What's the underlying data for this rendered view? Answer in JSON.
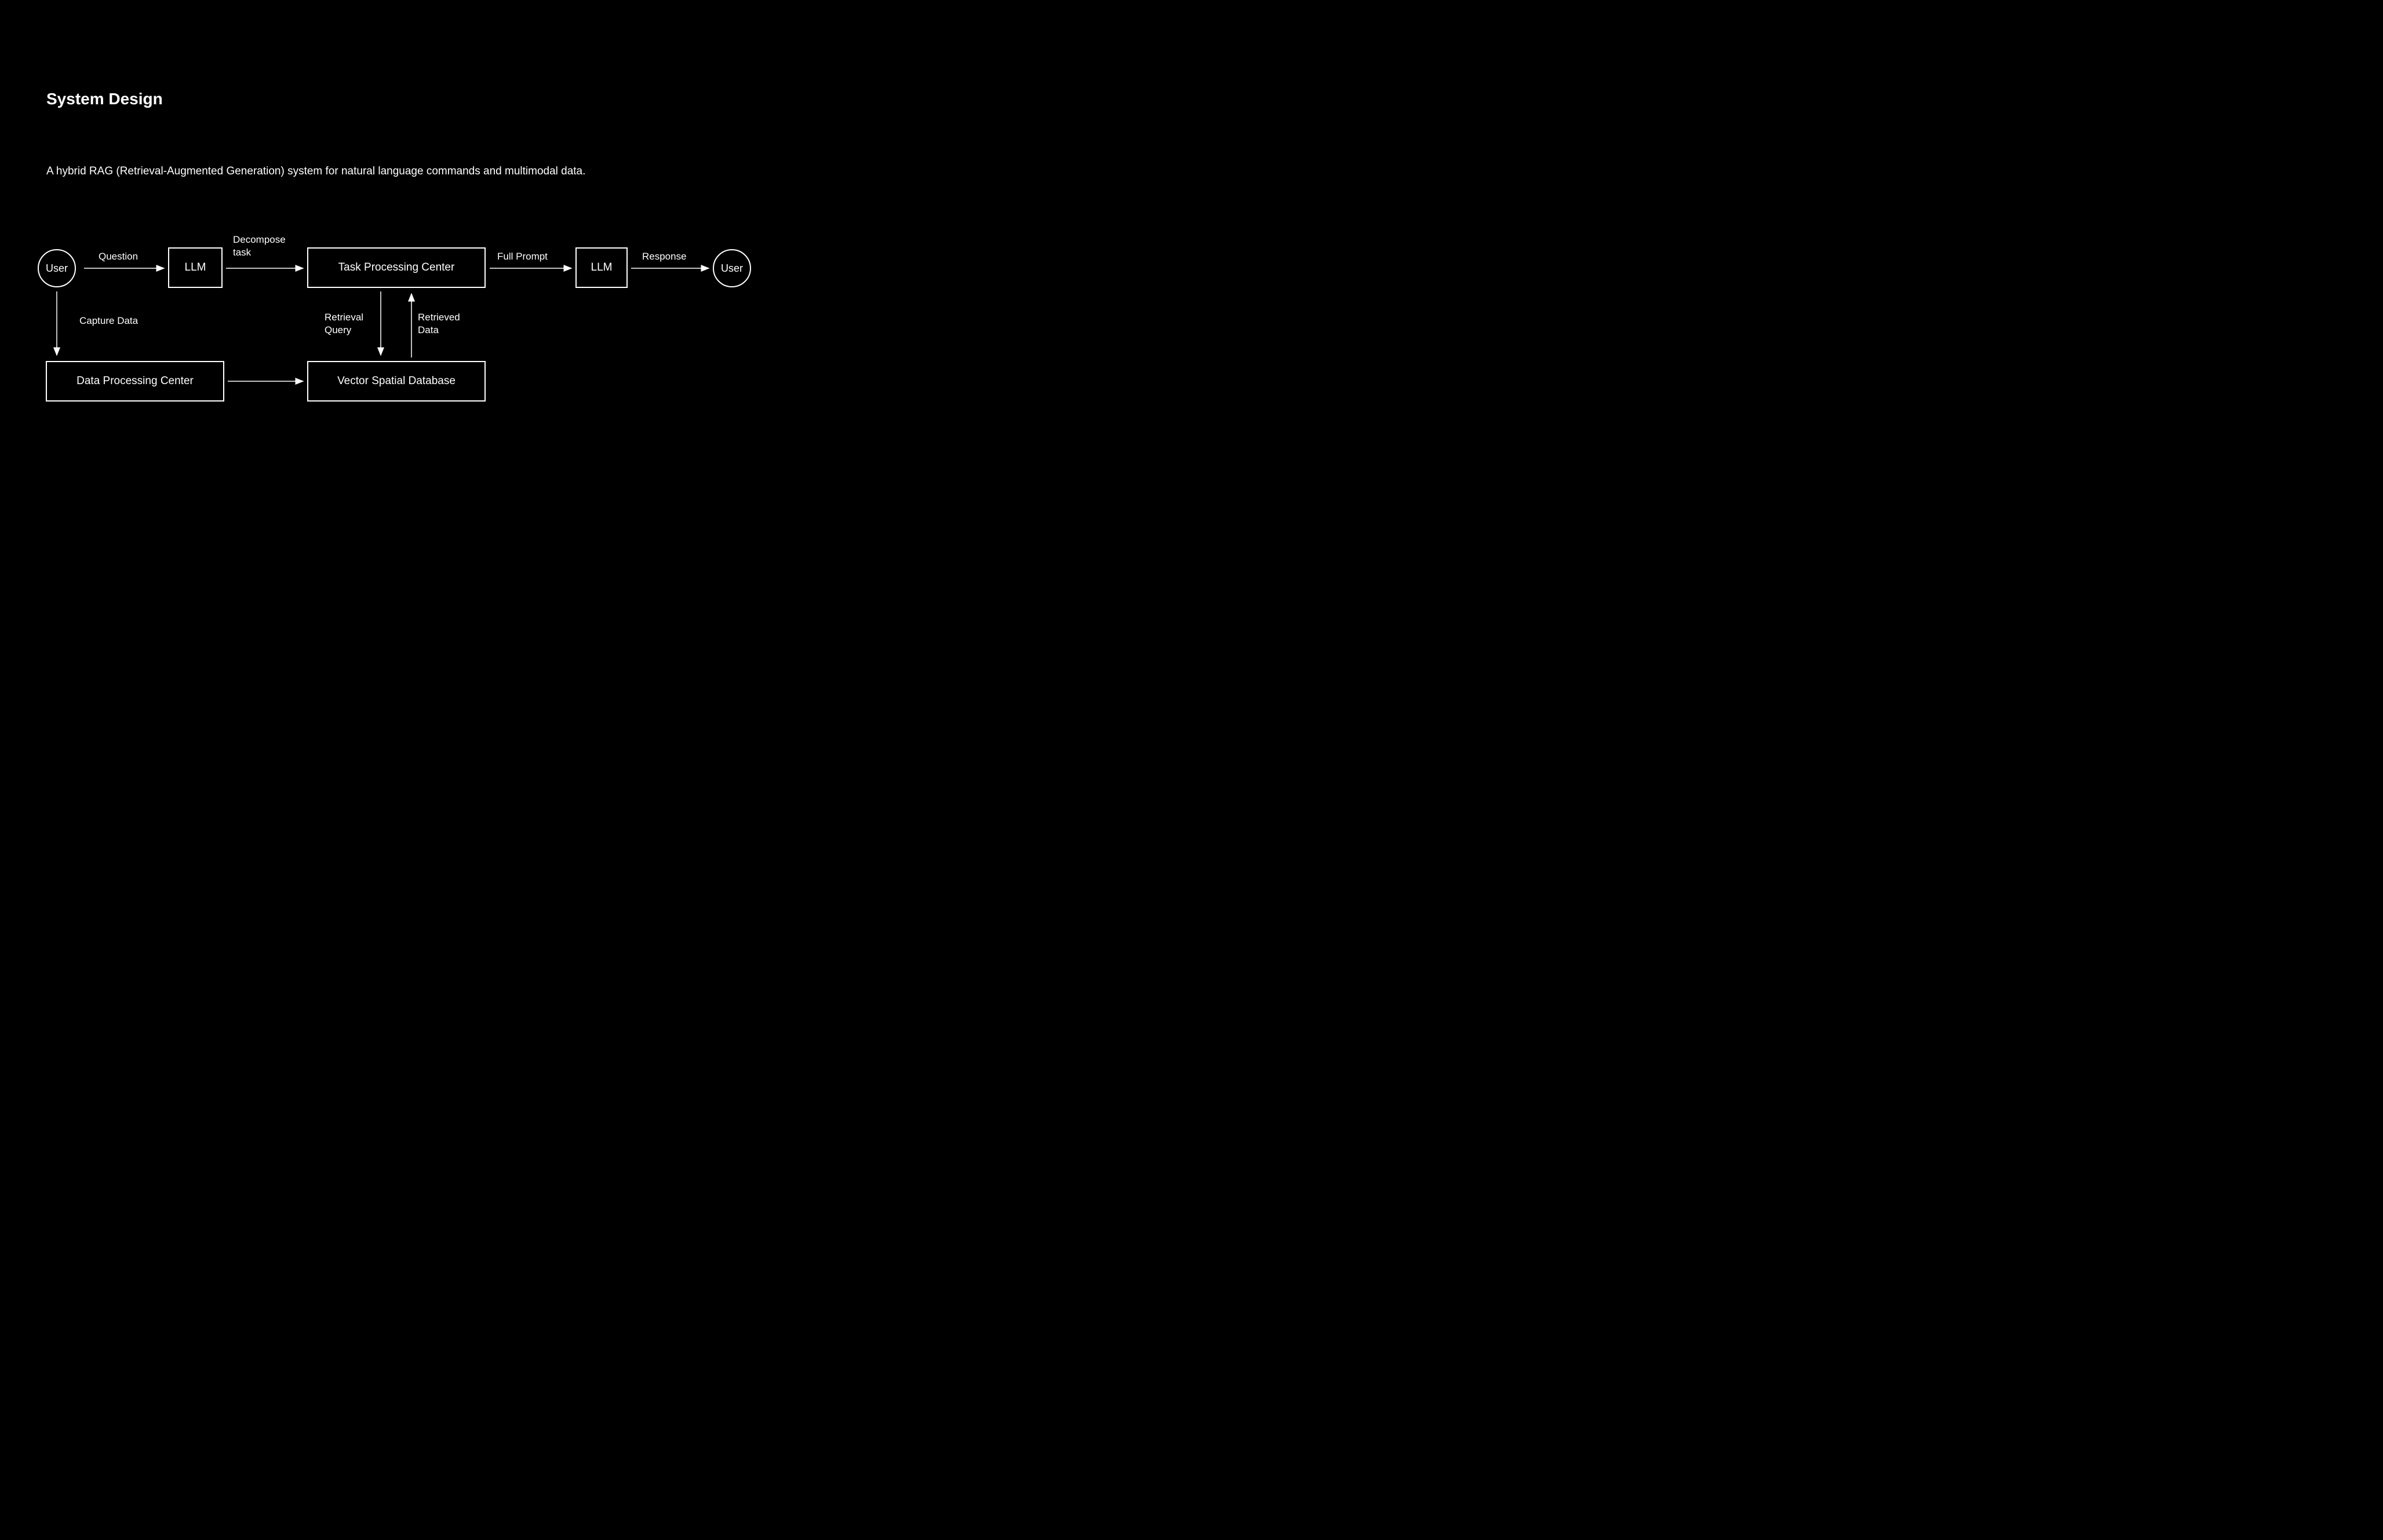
{
  "title": "System Design",
  "subtitle": "A hybrid RAG (Retrieval-Augmented Generation) system for natural language commands and multimodal data.",
  "nodes": {
    "user_start": "User",
    "llm_1": "LLM",
    "task_processing": "Task Processing Center",
    "llm_2": "LLM",
    "user_end": "User",
    "data_processing": "Data Processing Center",
    "vector_db": "Vector Spatial Database"
  },
  "edges": {
    "question": "Question",
    "decompose_task_l1": "Decompose",
    "decompose_task_l2": "task",
    "full_prompt": "Full Prompt",
    "response": "Response",
    "capture_data": "Capture Data",
    "retrieval_query_l1": "Retrieval",
    "retrieval_query_l2": "Query",
    "retrieved_data_l1": "Retrieved",
    "retrieved_data_l2": "Data"
  }
}
